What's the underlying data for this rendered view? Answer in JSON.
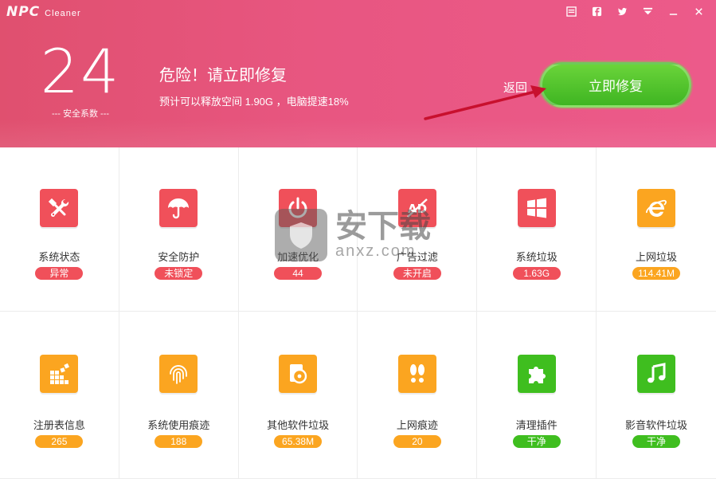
{
  "app": {
    "logo_mark": "NPC",
    "logo_sub": "Cleaner"
  },
  "window_controls": [
    "menu-icon",
    "facebook-icon",
    "twitter-icon",
    "dropdown-icon",
    "minimize-icon",
    "close-icon"
  ],
  "score": {
    "value": "24",
    "label": "--- 安全系数 ---"
  },
  "warning": {
    "title": "危险！请立即修复",
    "desc": "预计可以释放空间 1.90G ，电脑提速18%"
  },
  "actions": {
    "back": "返回",
    "fix": "立即修复"
  },
  "colors": {
    "header": "#e85681",
    "red": "#f0505a",
    "orange": "#fba520",
    "green": "#3fbe1f"
  },
  "items": [
    {
      "label": "系统状态",
      "status": "异常",
      "color": "red",
      "icon": "tools-icon"
    },
    {
      "label": "安全防护",
      "status": "未锁定",
      "color": "red",
      "icon": "umbrella-icon"
    },
    {
      "label": "加速优化",
      "status": "44",
      "color": "red",
      "icon": "power-icon"
    },
    {
      "label": "广告过滤",
      "status": "未开启",
      "color": "red",
      "icon": "ad-block-icon"
    },
    {
      "label": "系统垃圾",
      "status": "1.63G",
      "color": "red",
      "icon": "windows-icon"
    },
    {
      "label": "上网垃圾",
      "status": "114.41M",
      "color": "orange",
      "icon": "ie-icon"
    },
    {
      "label": "注册表信息",
      "status": "265",
      "color": "orange",
      "icon": "registry-icon"
    },
    {
      "label": "系统使用痕迹",
      "status": "188",
      "color": "orange",
      "icon": "fingerprint-icon"
    },
    {
      "label": "其他软件垃圾",
      "status": "65.38M",
      "color": "orange",
      "icon": "disc-icon"
    },
    {
      "label": "上网痕迹",
      "status": "20",
      "color": "orange",
      "icon": "footprint-icon"
    },
    {
      "label": "清理插件",
      "status": "干净",
      "color": "green",
      "icon": "puzzle-icon"
    },
    {
      "label": "影音软件垃圾",
      "status": "干净",
      "color": "green",
      "icon": "music-icon"
    }
  ],
  "watermark": {
    "text": "安下载",
    "sub": "anxz.com"
  }
}
